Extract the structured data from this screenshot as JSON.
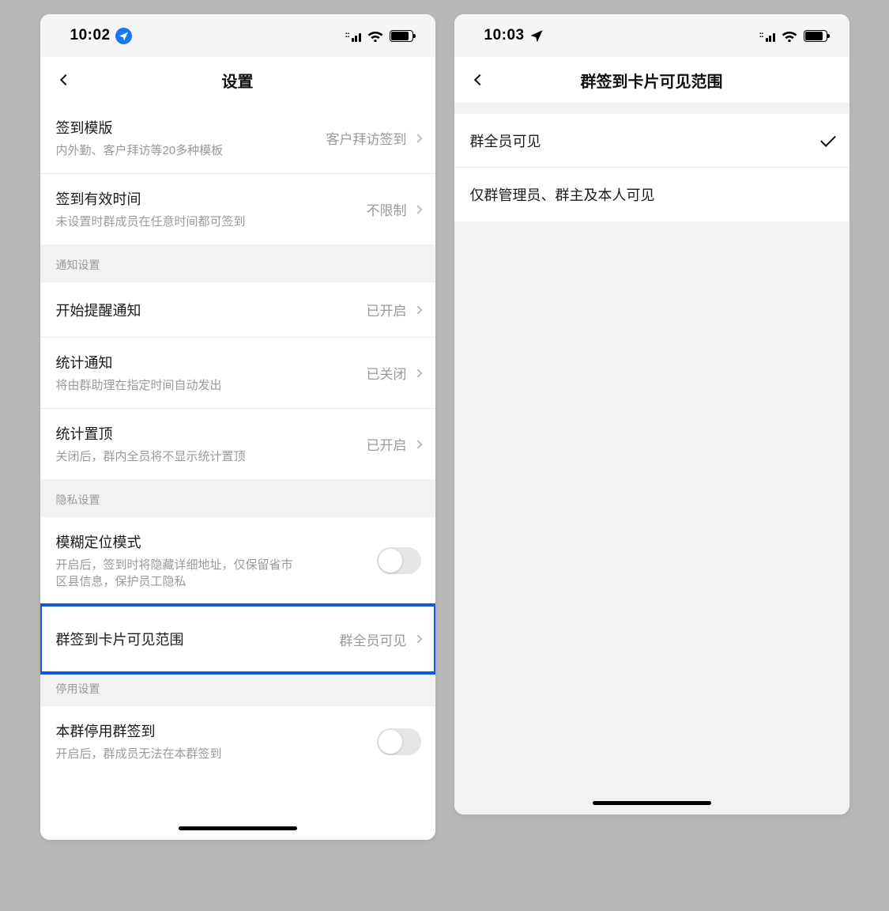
{
  "left": {
    "status": {
      "time": "10:02"
    },
    "nav": {
      "title": "设置"
    },
    "topList": [
      {
        "title": "签到模版",
        "sub": "内外勤、客户拜访等20多种模板",
        "value": "客户拜访签到"
      },
      {
        "title": "签到有效时间",
        "sub": "未设置时群成员在任意时间都可签到",
        "value": "不限制"
      }
    ],
    "notifHeader": "通知设置",
    "notifList": [
      {
        "title": "开始提醒通知",
        "sub": "",
        "value": "已开启"
      },
      {
        "title": "统计通知",
        "sub": "将由群助理在指定时间自动发出",
        "value": "已关闭"
      },
      {
        "title": "统计置顶",
        "sub": "关闭后，群内全员将不显示统计置顶",
        "value": "已开启"
      }
    ],
    "privacyHeader": "隐私设置",
    "privacyList": [
      {
        "title": "模糊定位模式",
        "sub": "开启后，签到时将隐藏详细地址，仅保留省市区县信息，保护员工隐私"
      },
      {
        "title": "群签到卡片可见范围",
        "value": "群全员可见"
      }
    ],
    "disableHeader": "停用设置",
    "disableList": [
      {
        "title": "本群停用群签到",
        "sub": "开启后，群成员无法在本群签到"
      }
    ]
  },
  "right": {
    "status": {
      "time": "10:03"
    },
    "nav": {
      "title": "群签到卡片可见范围"
    },
    "options": [
      {
        "label": "群全员可见",
        "checked": true
      },
      {
        "label": "仅群管理员、群主及本人可见",
        "checked": false
      }
    ]
  }
}
